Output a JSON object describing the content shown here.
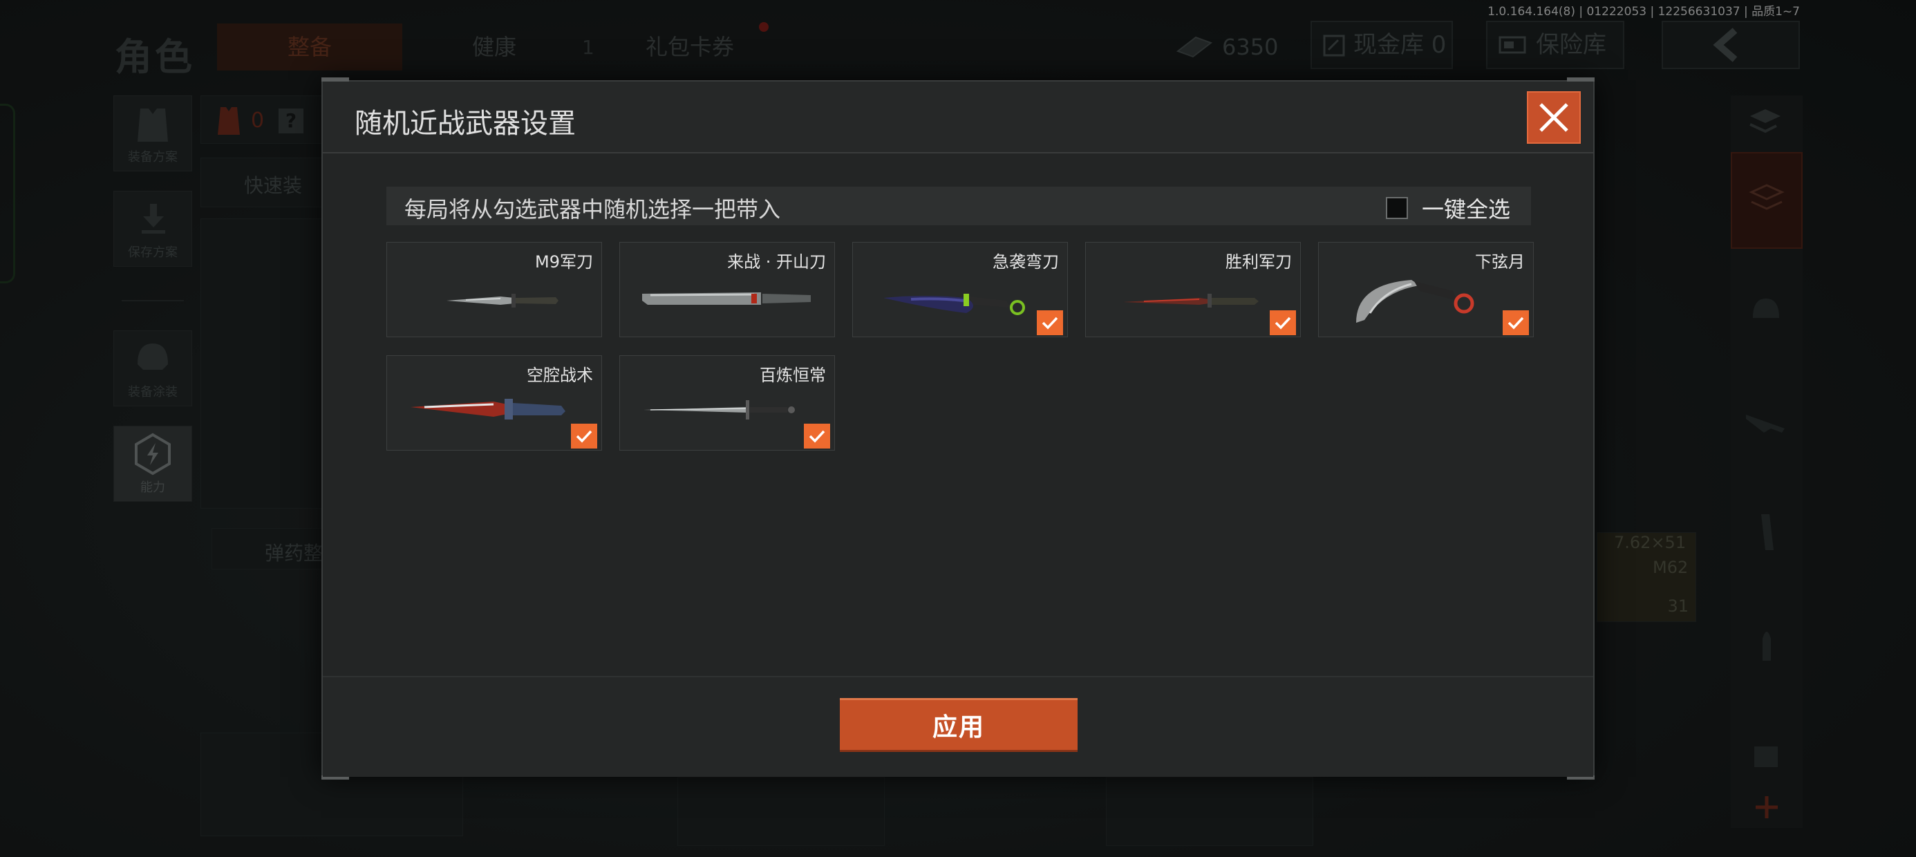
{
  "version": "1.0.164.164(8) | 01222053 | 12256631037 | 品质1~7",
  "background": {
    "title": "角色",
    "tabs": [
      "整备",
      "健康",
      "礼包卡券"
    ],
    "tab_badge": "1",
    "currency_value": "6350",
    "cash_vault": "现金库 0",
    "insurance_vault": "保险库",
    "left_tiles": [
      "装备方案",
      "保存方案",
      "装备涂装",
      "能力"
    ],
    "counter_value": "0",
    "quick_equip": "快速装",
    "ammo_label": "弹药整",
    "ammo_caliber": "7.62×51",
    "ammo_name": "M62",
    "ammo_count": "31"
  },
  "modal": {
    "title": "随机近战武器设置",
    "info_text": "每局将从勾选武器中随机选择一把带入",
    "select_all_label": "一键全选",
    "select_all_checked": false,
    "apply_label": "应用",
    "weapons": [
      {
        "name": "M9军刀",
        "checked": false,
        "icon": "m9-bayonet-icon"
      },
      {
        "name": "来战 · 开山刀",
        "checked": false,
        "icon": "machete-icon"
      },
      {
        "name": "急袭弯刀",
        "checked": true,
        "icon": "raid-scimitar-icon"
      },
      {
        "name": "胜利军刀",
        "checked": true,
        "icon": "victory-knife-icon"
      },
      {
        "name": "下弦月",
        "checked": true,
        "icon": "karambit-icon"
      },
      {
        "name": "空腔战术",
        "checked": true,
        "icon": "tactical-dagger-icon"
      },
      {
        "name": "百炼恒常",
        "checked": true,
        "icon": "long-sword-icon"
      }
    ]
  },
  "colors": {
    "accent": "#ee6a2e",
    "close_button": "#c7502a",
    "apply_button": "#c55026"
  }
}
